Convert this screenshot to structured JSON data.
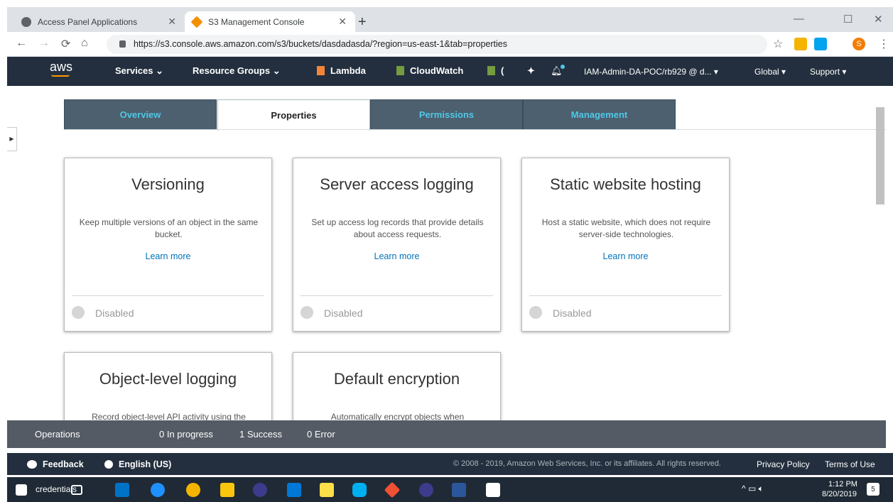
{
  "browser": {
    "tabs": [
      {
        "label": "Access Panel Applications"
      },
      {
        "label": "S3 Management Console"
      }
    ],
    "url": "https://s3.console.aws.amazon.com/s3/buckets/dasdadasda/?region=us-east-1&tab=properties",
    "new_tab_label": "+",
    "profile_initial": "S"
  },
  "aws_nav": {
    "logo": "aws",
    "services": "Services",
    "resource_groups": "Resource Groups",
    "lambda": "Lambda",
    "cloudwatch": "CloudWatch",
    "truncated": "(",
    "account": "IAM-Admin-DA-POC/rb929 @ d...",
    "region": "Global",
    "support": "Support"
  },
  "tabs": [
    {
      "label": "Overview"
    },
    {
      "label": "Properties"
    },
    {
      "label": "Permissions"
    },
    {
      "label": "Management"
    }
  ],
  "cards": [
    {
      "title": "Versioning",
      "description": "Keep multiple versions of an object in the same bucket.",
      "link": "Learn more",
      "status": "Disabled"
    },
    {
      "title": "Server access logging",
      "description": "Set up access log records that provide details about access requests.",
      "link": "Learn more",
      "status": "Disabled"
    },
    {
      "title": "Static website hosting",
      "description": "Host a static website, which does not require server-side technologies.",
      "link": "Learn more",
      "status": "Disabled"
    },
    {
      "title": "Object-level logging",
      "description": "Record object-level API activity using the"
    },
    {
      "title": "Default encryption",
      "description": "Automatically encrypt objects when"
    }
  ],
  "operations": {
    "label": "Operations",
    "in_progress": "0 In progress",
    "success": "1 Success",
    "error": "0 Error"
  },
  "footer": {
    "feedback": "Feedback",
    "language": "English (US)",
    "copyright": "© 2008 - 2019, Amazon Web Services, Inc. or its affiliates. All rights reserved.",
    "privacy": "Privacy Policy",
    "terms": "Terms of Use"
  },
  "taskbar": {
    "search_text": "credentials",
    "time": "1:12 PM",
    "date": "8/20/2019",
    "notifications": "5"
  }
}
